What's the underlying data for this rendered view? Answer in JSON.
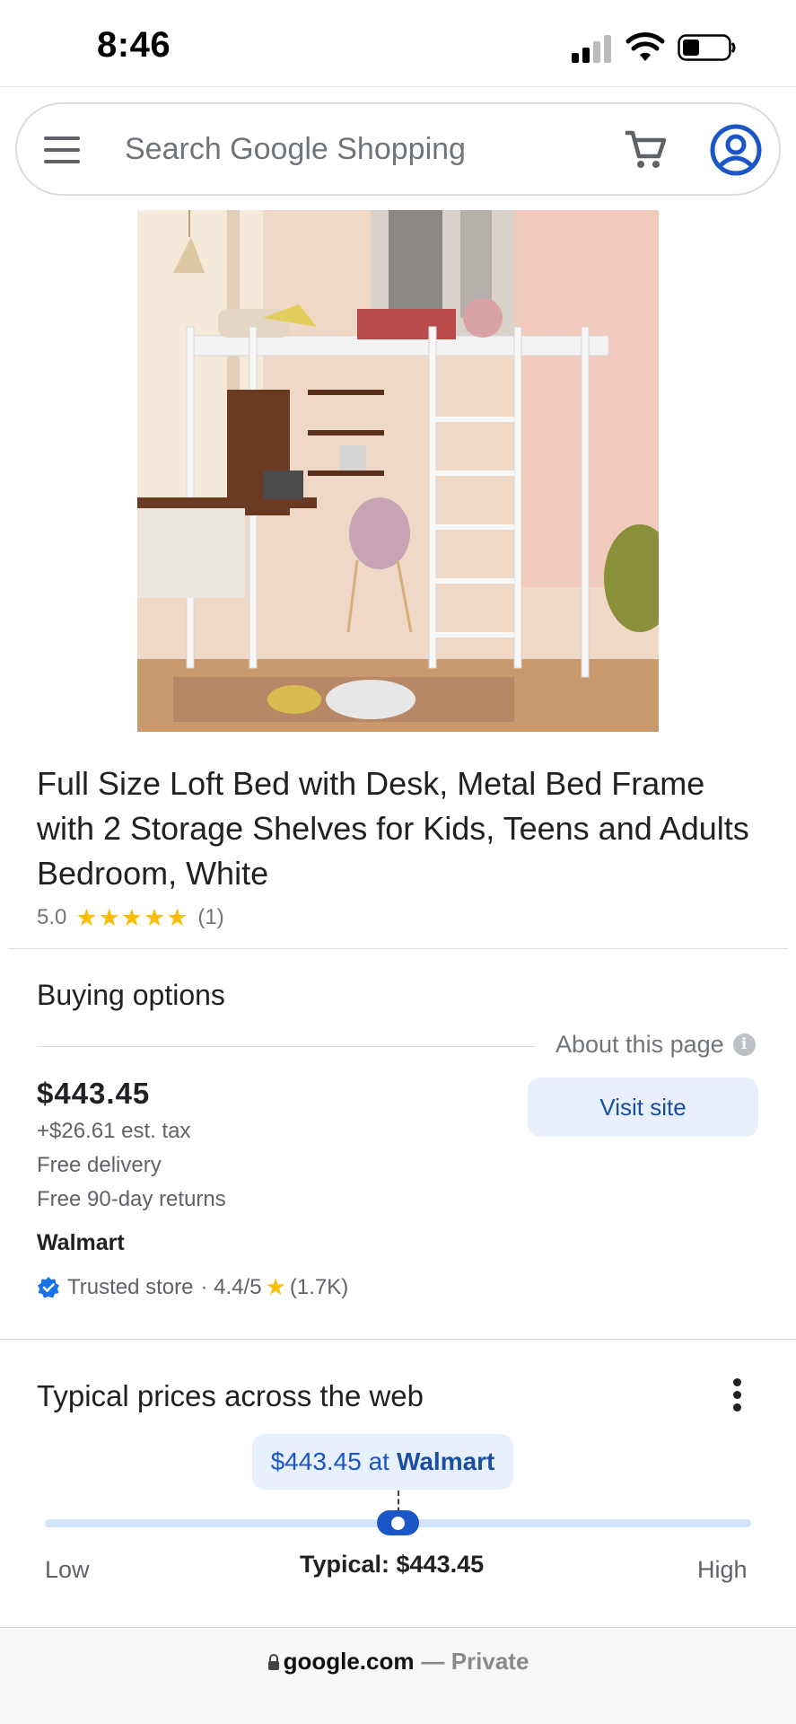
{
  "status_bar": {
    "time": "8:46"
  },
  "search": {
    "placeholder": "Search Google Shopping"
  },
  "product": {
    "title": "Full Size Loft Bed with Desk, Metal Bed Frame with 2 Storage Shelves for Kids, Teens and Adults Bedroom, White",
    "rating": "5.0",
    "stars": "★★★★★",
    "review_count": "(1)"
  },
  "buying_options": {
    "heading": "Buying options",
    "about_label": "About this page",
    "price": "$443.45",
    "tax": "+$26.61 est. tax",
    "delivery": "Free delivery",
    "returns": "Free 90-day returns",
    "store": "Walmart",
    "trusted_label": "Trusted store",
    "store_rating": "· 4.4/5",
    "store_reviews": "(1.7K)",
    "visit_label": "Visit site"
  },
  "typical_prices": {
    "heading": "Typical prices across the web",
    "tooltip_price": "$443.45 at",
    "tooltip_store": "Walmart",
    "low_label": "Low",
    "typical_label": "Typical: $443.45",
    "high_label": "High"
  },
  "browser_bar": {
    "domain": "google.com",
    "privacy": "— Private"
  },
  "colors": {
    "accent_blue": "#1a56c6",
    "star_yellow": "#fbbc04",
    "chip_background": "#e8f0fe"
  },
  "icons": [
    "menu-icon",
    "cart-icon",
    "account-icon",
    "info-icon",
    "verified-icon",
    "star-icon",
    "more-vert-icon",
    "lock-icon",
    "signal-icon",
    "wifi-icon",
    "battery-icon"
  ]
}
